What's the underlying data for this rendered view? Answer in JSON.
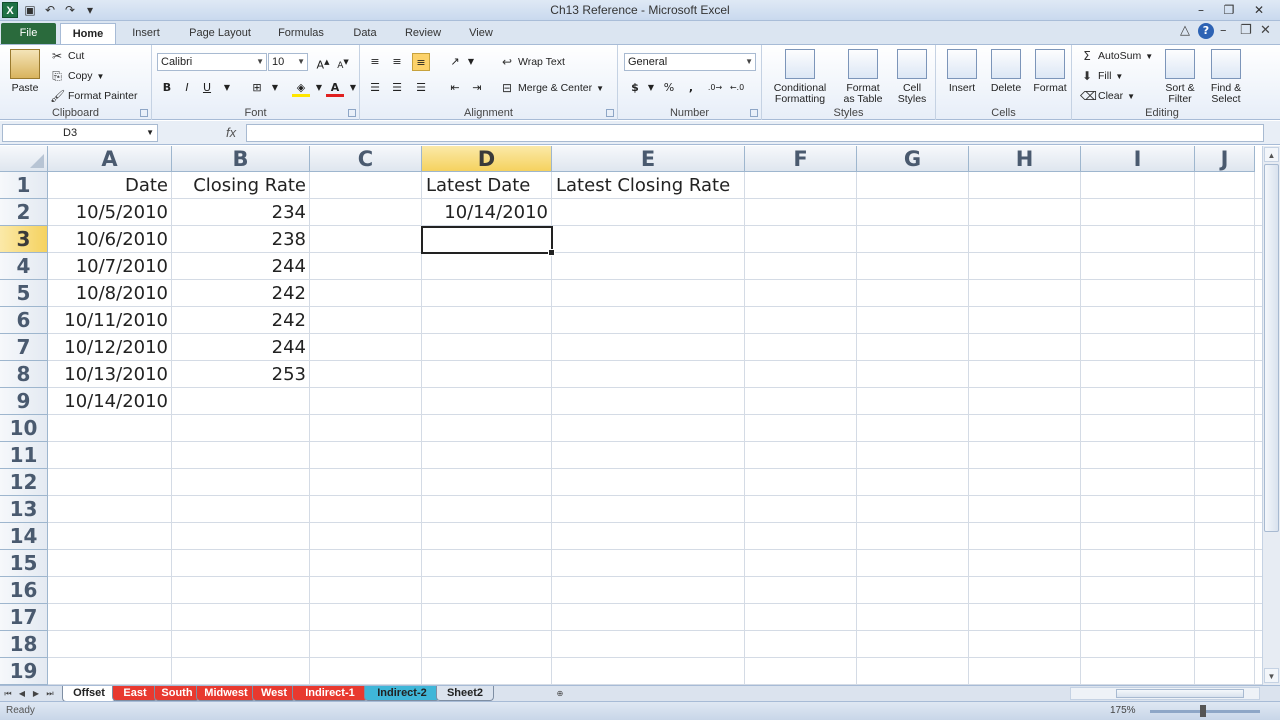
{
  "window": {
    "title": "Ch13 Reference - Microsoft Excel",
    "minimize": "–",
    "maximize": "❐",
    "close": "✕"
  },
  "quick_access": {
    "logo": "X",
    "save_icon": "💾",
    "undo_icon": "↶",
    "redo_icon": "↷",
    "customize_icon": "▾"
  },
  "tabs": [
    "File",
    "Home",
    "Insert",
    "Page Layout",
    "Formulas",
    "Data",
    "Review",
    "View"
  ],
  "ribbon": {
    "clipboard": {
      "label": "Clipboard",
      "paste": "Paste",
      "cut": "Cut",
      "copy": "Copy",
      "format_painter": "Format Painter"
    },
    "font": {
      "label": "Font",
      "font_name": "Calibri",
      "font_size": "10",
      "bold": "B",
      "italic": "I",
      "underline": "U"
    },
    "alignment": {
      "label": "Alignment",
      "wrap_text": "Wrap Text",
      "merge_center": "Merge & Center"
    },
    "number": {
      "label": "Number",
      "format": "General",
      "currency": "$",
      "percent": "%",
      "comma": ","
    },
    "styles": {
      "label": "Styles",
      "conditional_formatting_1": "Conditional",
      "conditional_formatting_2": "Formatting",
      "format_as_table_1": "Format",
      "format_as_table_2": "as Table",
      "cell_styles_1": "Cell",
      "cell_styles_2": "Styles"
    },
    "cells": {
      "label": "Cells",
      "insert": "Insert",
      "delete": "Delete",
      "format": "Format"
    },
    "editing": {
      "label": "Editing",
      "autosum": "AutoSum",
      "fill": "Fill",
      "clear": "Clear",
      "sort_filter_1": "Sort &",
      "sort_filter_2": "Filter",
      "find_select_1": "Find &",
      "find_select_2": "Select"
    }
  },
  "formula_bar": {
    "name_box": "D3",
    "fx": "fx",
    "formula": ""
  },
  "grid": {
    "columns": [
      "A",
      "B",
      "C",
      "D",
      "E",
      "F",
      "G",
      "H",
      "I",
      "J"
    ],
    "selected_column": "D",
    "rows": [
      "1",
      "2",
      "3",
      "4",
      "5",
      "6",
      "7",
      "8",
      "9",
      "10",
      "11",
      "12",
      "13",
      "14",
      "15",
      "16",
      "17",
      "18",
      "19"
    ],
    "selected_row": "3",
    "cells": {
      "A1": "Date",
      "B1": "Closing Rate",
      "D1": "Latest Date",
      "E1": "Latest Closing Rate",
      "A2": "10/5/2010",
      "B2": "234",
      "D2": "10/14/2010",
      "A3": "10/6/2010",
      "B3": "238",
      "A4": "10/7/2010",
      "B4": "244",
      "A5": "10/8/2010",
      "B5": "242",
      "A6": "10/11/2010",
      "B6": "242",
      "A7": "10/12/2010",
      "B7": "244",
      "A8": "10/13/2010",
      "B8": "253",
      "A9": "10/14/2010"
    }
  },
  "sheet_tabs": [
    {
      "name": "Offset",
      "color": "#ffffff",
      "active": true
    },
    {
      "name": "East",
      "color": "#e8392f"
    },
    {
      "name": "South",
      "color": "#e8392f"
    },
    {
      "name": "Midwest",
      "color": "#e8392f"
    },
    {
      "name": "West",
      "color": "#e8392f"
    },
    {
      "name": "Indirect-1",
      "color": "#e8392f"
    },
    {
      "name": "Indirect-2",
      "color": "#3fb6d8"
    },
    {
      "name": "Sheet2",
      "color": "#dbe3ee"
    }
  ],
  "status_bar": {
    "status": "Ready",
    "zoom": "175%"
  }
}
